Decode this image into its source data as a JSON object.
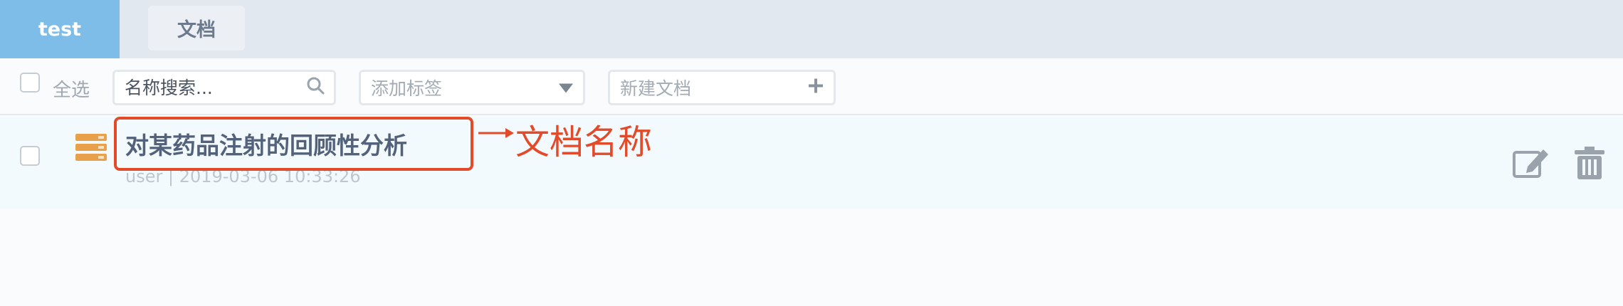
{
  "tabs": [
    {
      "label": "test",
      "active": true
    },
    {
      "label": "文档",
      "active": false
    }
  ],
  "toolbar": {
    "select_all_label": "全选",
    "search_placeholder": "名称搜索...",
    "tag_placeholder": "添加标签",
    "new_doc_placeholder": "新建文档"
  },
  "documents": [
    {
      "title": "对某药品注射的回顾性分析",
      "meta": "user | 2019-03-06 10:33:26"
    }
  ],
  "annotation": {
    "label": "文档名称",
    "color": "#e24a2a"
  },
  "colors": {
    "tab_active": "#7dbde8",
    "topbar": "#e1e8f0",
    "doc_icon": "#e8a04a",
    "title": "#53627a"
  },
  "icons": {
    "search": "search-icon",
    "dropdown": "caret-down-icon",
    "add": "plus-icon",
    "document": "stack-icon",
    "edit": "edit-icon",
    "delete": "trash-icon"
  }
}
